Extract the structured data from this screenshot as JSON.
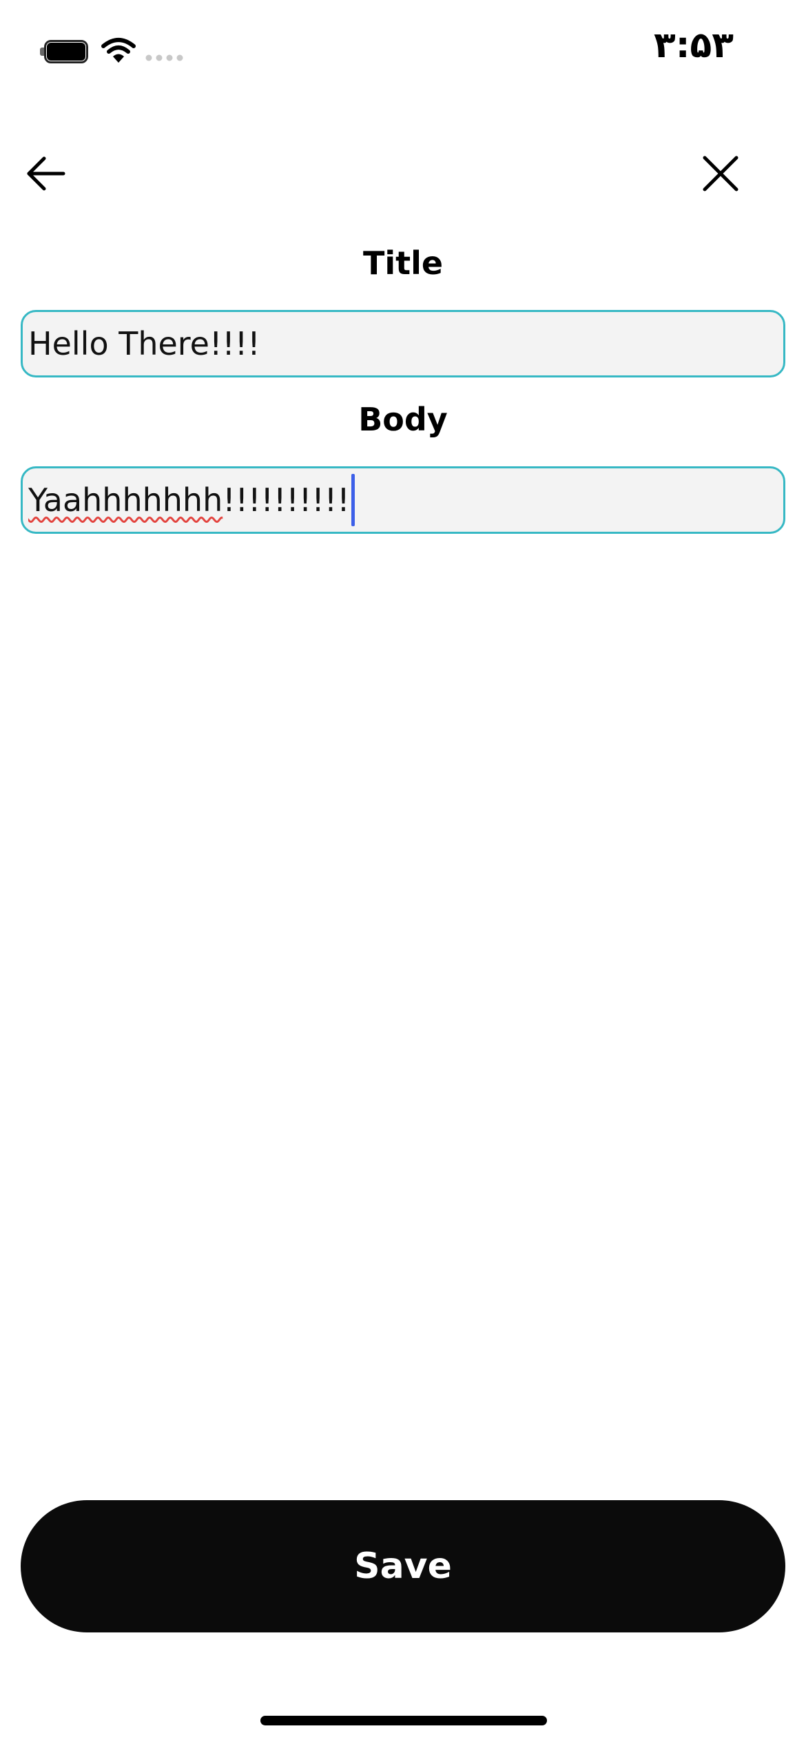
{
  "status_bar": {
    "time": "۳:۵۳",
    "battery_icon": "battery-icon",
    "wifi_icon": "wifi-icon",
    "signal_icon": "cellular-signal-icon"
  },
  "nav": {
    "back_icon": "arrow-left-icon",
    "close_icon": "close-icon"
  },
  "form": {
    "title_label": "Title",
    "title_value": "Hello There!!!!",
    "body_label": "Body",
    "body_value_misspelled": "Yaahhhhhhh",
    "body_value_rest": "!!!!!!!!!!"
  },
  "actions": {
    "save_label": "Save"
  },
  "colors": {
    "field_border": "#36b8c4",
    "field_background": "#f3f3f3",
    "caret": "#3c5fe8",
    "spellcheck_underline": "#e3433e",
    "button_background": "#0b0b0b",
    "button_text": "#ffffff"
  }
}
